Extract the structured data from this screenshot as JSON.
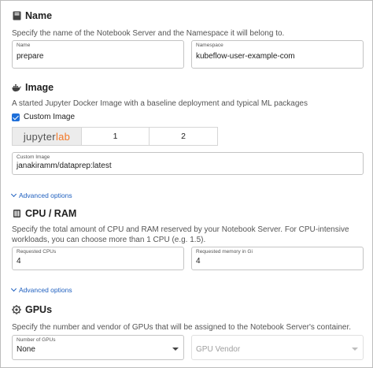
{
  "name_section": {
    "title": "Name",
    "icon": "book-icon",
    "description": "Specify the name of the Notebook Server and the Namespace it will belong to.",
    "name_field": {
      "label": "Name",
      "value": "prepare"
    },
    "namespace_field": {
      "label": "Namespace",
      "value": "kubeflow-user-example-com"
    }
  },
  "image_section": {
    "title": "Image",
    "icon": "docker-whale-icon",
    "description": "A started Jupyter Docker Image with a baseline deployment and typical ML packages",
    "custom_image_checkbox": {
      "label": "Custom Image",
      "checked": true
    },
    "tabs": [
      {
        "label_part1": "jupyter",
        "label_part2": "lab",
        "active": true
      },
      {
        "label": "1",
        "active": false
      },
      {
        "label": "2",
        "active": false
      }
    ],
    "custom_image_field": {
      "label": "Custom Image",
      "value": "janakiramm/dataprep:latest"
    },
    "advanced_options": "Advanced options"
  },
  "cpu_ram_section": {
    "title": "CPU / RAM",
    "icon": "memory-chip-icon",
    "description": "Specify the total amount of CPU and RAM reserved by your Notebook Server. For CPU-intensive workloads, you can choose more than 1 CPU (e.g. 1.5).",
    "cpu_field": {
      "label": "Requested CPUs",
      "value": "4"
    },
    "memory_field": {
      "label": "Requested memory in Gi",
      "value": "4"
    },
    "advanced_options": "Advanced options"
  },
  "gpu_section": {
    "title": "GPUs",
    "icon": "gpu-chip-icon",
    "description": "Specify the number and vendor of GPUs that will be assigned to the Notebook Server's container.",
    "gpu_count_field": {
      "label": "Number of GPUs",
      "value": "None"
    },
    "gpu_vendor_field": {
      "placeholder": "GPU Vendor"
    }
  },
  "colors": {
    "link": "#1e5fbf",
    "checkbox": "#1e6fd9",
    "jupyter_orange": "#f37726"
  }
}
